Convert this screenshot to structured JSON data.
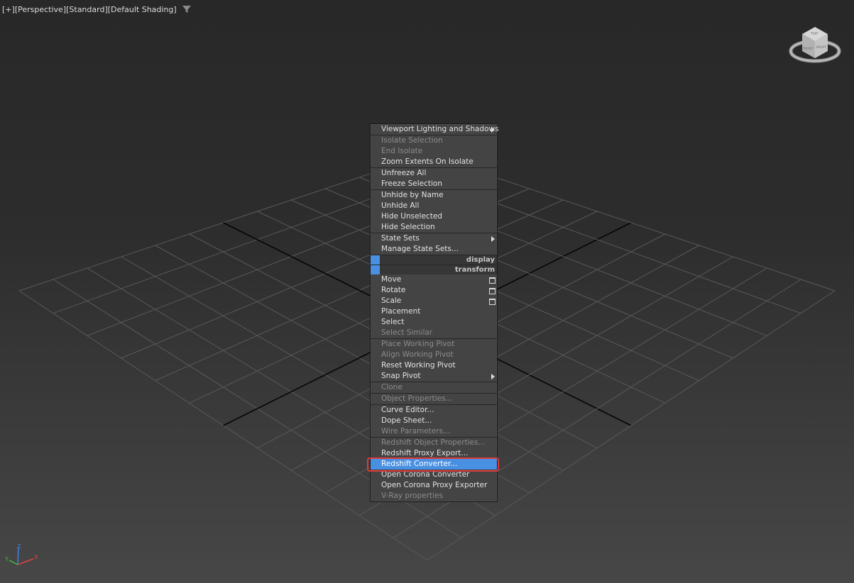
{
  "viewport": {
    "label_plus": "[+]",
    "label_view": "[Perspective]",
    "label_mode": "[Standard]",
    "label_shading": "[Default Shading]"
  },
  "viewcube": {
    "front": "FRONT",
    "top": "TOP",
    "right": "RIGHT"
  },
  "axis": {
    "x": "X",
    "y": "Y",
    "z": "Z"
  },
  "colors": {
    "menu_bg": "#444444",
    "highlight": "#4a90e2",
    "annotation_ring": "#e13a3a",
    "grid_line": "#595959"
  },
  "menu": {
    "g1": [
      {
        "label": "Viewport Lighting and Shadows",
        "disabled": false,
        "submenu": true
      }
    ],
    "g2": [
      {
        "label": "Isolate Selection",
        "disabled": true
      },
      {
        "label": "End Isolate",
        "disabled": true
      },
      {
        "label": "Zoom Extents On Isolate",
        "disabled": false
      }
    ],
    "g3": [
      {
        "label": "Unfreeze All",
        "disabled": false
      },
      {
        "label": "Freeze Selection",
        "disabled": false
      }
    ],
    "g4": [
      {
        "label": "Unhide by Name",
        "disabled": false
      },
      {
        "label": "Unhide All",
        "disabled": false
      },
      {
        "label": "Hide Unselected",
        "disabled": false
      },
      {
        "label": "Hide Selection",
        "disabled": false
      }
    ],
    "g5": [
      {
        "label": "State Sets",
        "disabled": false,
        "submenu": true
      },
      {
        "label": "Manage State Sets...",
        "disabled": false
      }
    ],
    "header_display": "display",
    "header_transform": "transform",
    "g6": [
      {
        "label": "Move",
        "disabled": false,
        "options": true
      },
      {
        "label": "Rotate",
        "disabled": false,
        "options": true
      },
      {
        "label": "Scale",
        "disabled": false,
        "options": true
      },
      {
        "label": "Placement",
        "disabled": false
      },
      {
        "label": "Select",
        "disabled": false
      },
      {
        "label": "Select Similar",
        "disabled": true
      }
    ],
    "g7": [
      {
        "label": "Place Working Pivot",
        "disabled": true
      },
      {
        "label": "Align Working Pivot",
        "disabled": true
      },
      {
        "label": "Reset Working Pivot",
        "disabled": false
      },
      {
        "label": "Snap Pivot",
        "disabled": false,
        "submenu": true
      }
    ],
    "g8": [
      {
        "label": "Clone",
        "disabled": true
      }
    ],
    "g9": [
      {
        "label": "Object Properties...",
        "disabled": true
      }
    ],
    "g10": [
      {
        "label": "Curve Editor...",
        "disabled": false
      },
      {
        "label": "Dope Sheet...",
        "disabled": false
      },
      {
        "label": "Wire Parameters...",
        "disabled": true
      }
    ],
    "g11": [
      {
        "label": "Redshift Object Properties...",
        "disabled": true
      },
      {
        "label": "Redshift Proxy Export...",
        "disabled": false
      },
      {
        "label": "Redshift Converter...",
        "disabled": false,
        "highlighted": true
      },
      {
        "label": "Open Corona Converter",
        "disabled": false
      },
      {
        "label": "Open Corona Proxy Exporter",
        "disabled": false
      },
      {
        "label": "V-Ray properties",
        "disabled": true
      }
    ]
  }
}
